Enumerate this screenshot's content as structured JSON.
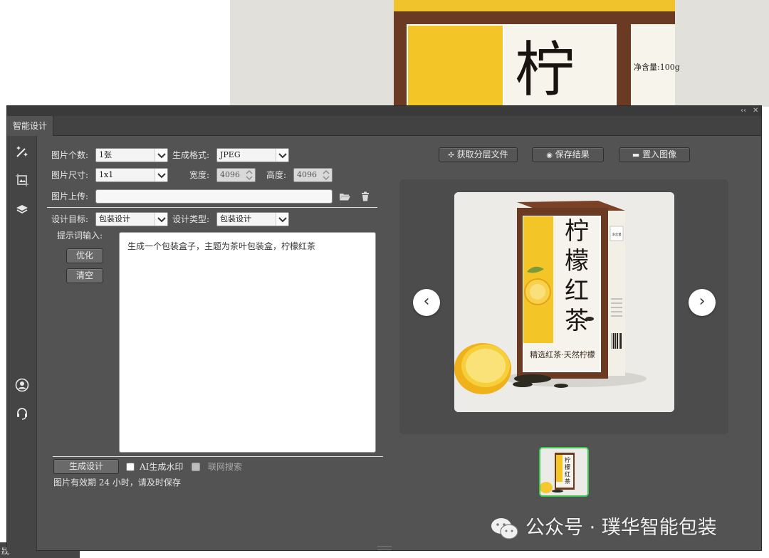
{
  "panel": {
    "tab_label": "智能设计",
    "collapse_icon": "‹‹",
    "close_icon": "✕"
  },
  "background": {
    "box_char": "柠",
    "side_text": "净含量:100g"
  },
  "stray_text": "戕",
  "form": {
    "count_label": "图片个数:",
    "count_value": "1张",
    "format_label": "生成格式:",
    "format_value": "JPEG",
    "size_label": "图片尺寸:",
    "size_value": "1x1",
    "width_label": "宽度:",
    "width_value": "4096",
    "height_label": "高度:",
    "height_value": "4096",
    "upload_label": "图片上传:",
    "upload_value": "",
    "target_label": "设计目标:",
    "target_value": "包装设计",
    "type_label": "设计类型:",
    "type_value": "包装设计",
    "prompt_label": "提示词输入:",
    "optimize_label": "优化",
    "clear_label": "清空",
    "prompt_value": "生成一个包装盒子，主题为茶叶包装盒，柠檬红茶",
    "generate_label": "生成设计",
    "watermark_label": "AI生成水印",
    "websearch_label": "联网搜索",
    "watermark_checked": false,
    "websearch_checked": false,
    "note": "图片有效期 24 小时，请及时保存"
  },
  "toolbar": {
    "get_layers_label": "获取分层文件",
    "save_label": "保存结果",
    "place_label": "置入图像"
  },
  "preview": {
    "prev_icon": "‹",
    "next_icon": "›",
    "box_title": "柠檬红茶",
    "box_subtitle": "精选红茶·天然柠檬",
    "box_net": "净含量:100g"
  },
  "footer": {
    "watermark_text": "公众号 · 璞华智能包装"
  },
  "colors": {
    "panel_bg": "#535353",
    "sidebar_bg": "#454545",
    "thumb_border": "#3cc850",
    "box_brown": "#6b3a22",
    "box_yellow": "#f3c526"
  }
}
